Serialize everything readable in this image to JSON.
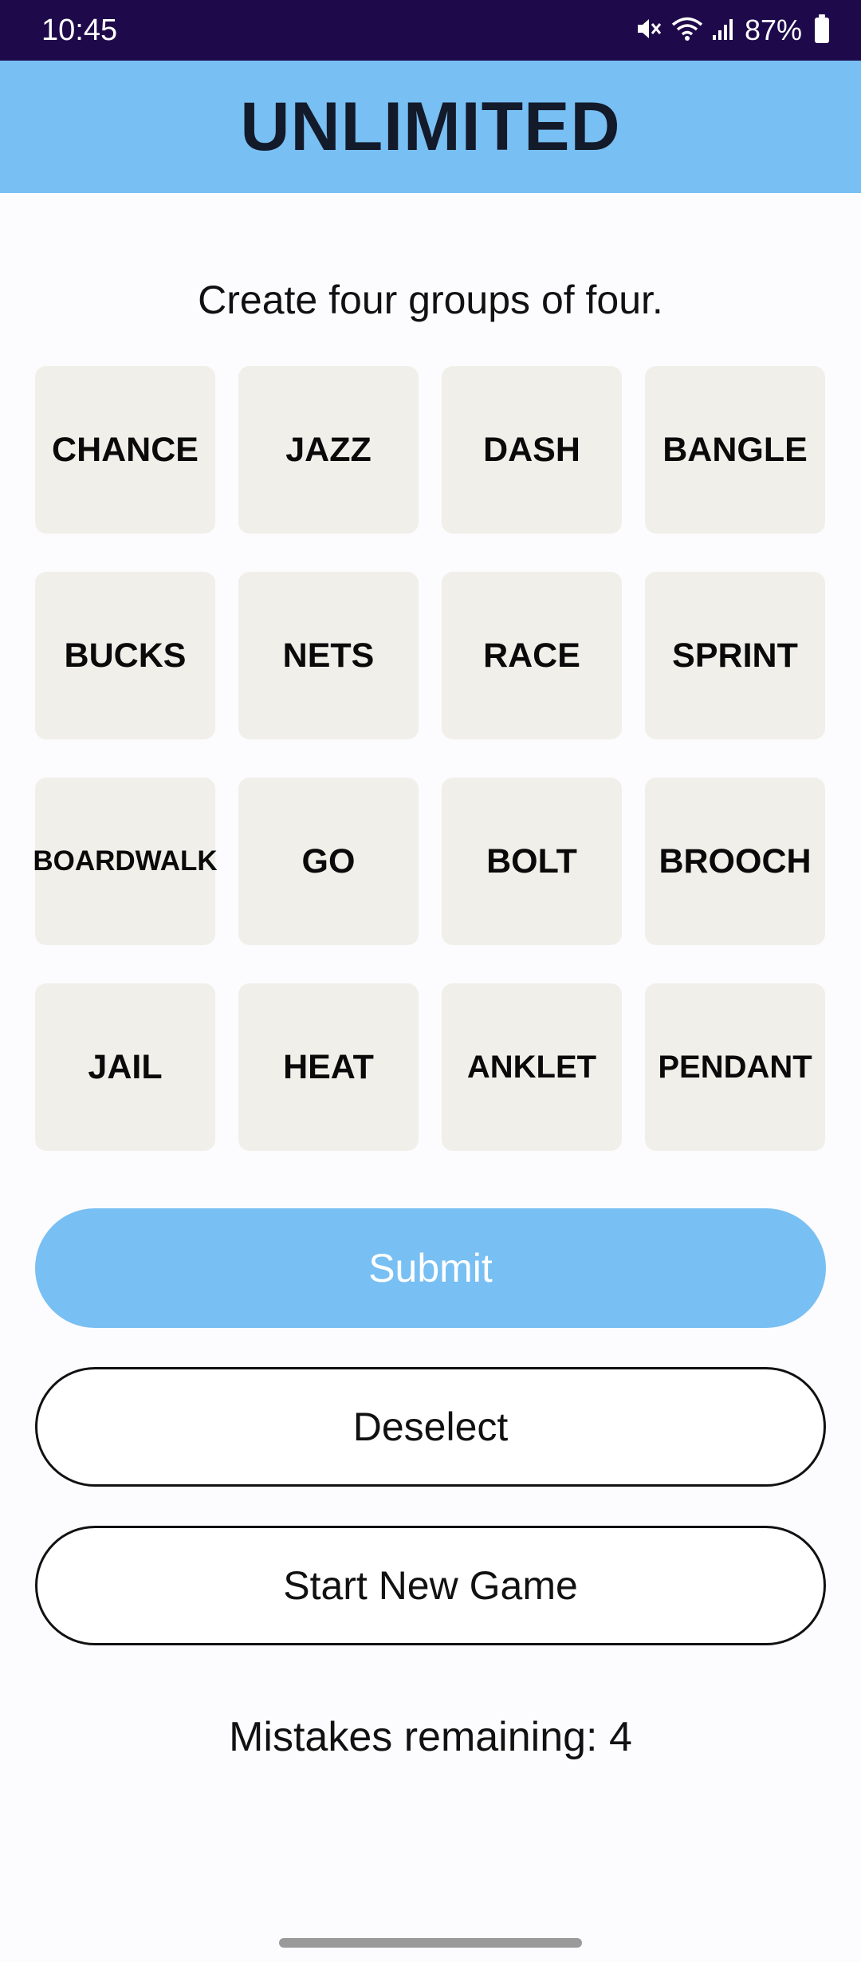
{
  "status_bar": {
    "time": "10:45",
    "battery_percent": "87%",
    "icons": [
      "mute-icon",
      "wifi-icon",
      "signal-icon",
      "battery-icon"
    ]
  },
  "header": {
    "title": "UNLIMITED"
  },
  "instructions": "Create four groups of four.",
  "tiles": [
    "CHANCE",
    "JAZZ",
    "DASH",
    "BANGLE",
    "BUCKS",
    "NETS",
    "RACE",
    "SPRINT",
    "BOARDWALK",
    "GO",
    "BOLT",
    "BROOCH",
    "JAIL",
    "HEAT",
    "ANKLET",
    "PENDANT"
  ],
  "buttons": {
    "submit": "Submit",
    "deselect": "Deselect",
    "new_game": "Start New Game"
  },
  "mistakes_text": "Mistakes remaining: 4",
  "colors": {
    "status_bar": "#1e0a4a",
    "header": "#78bff3",
    "tile": "#f1efe9",
    "submit": "#78bff3"
  }
}
